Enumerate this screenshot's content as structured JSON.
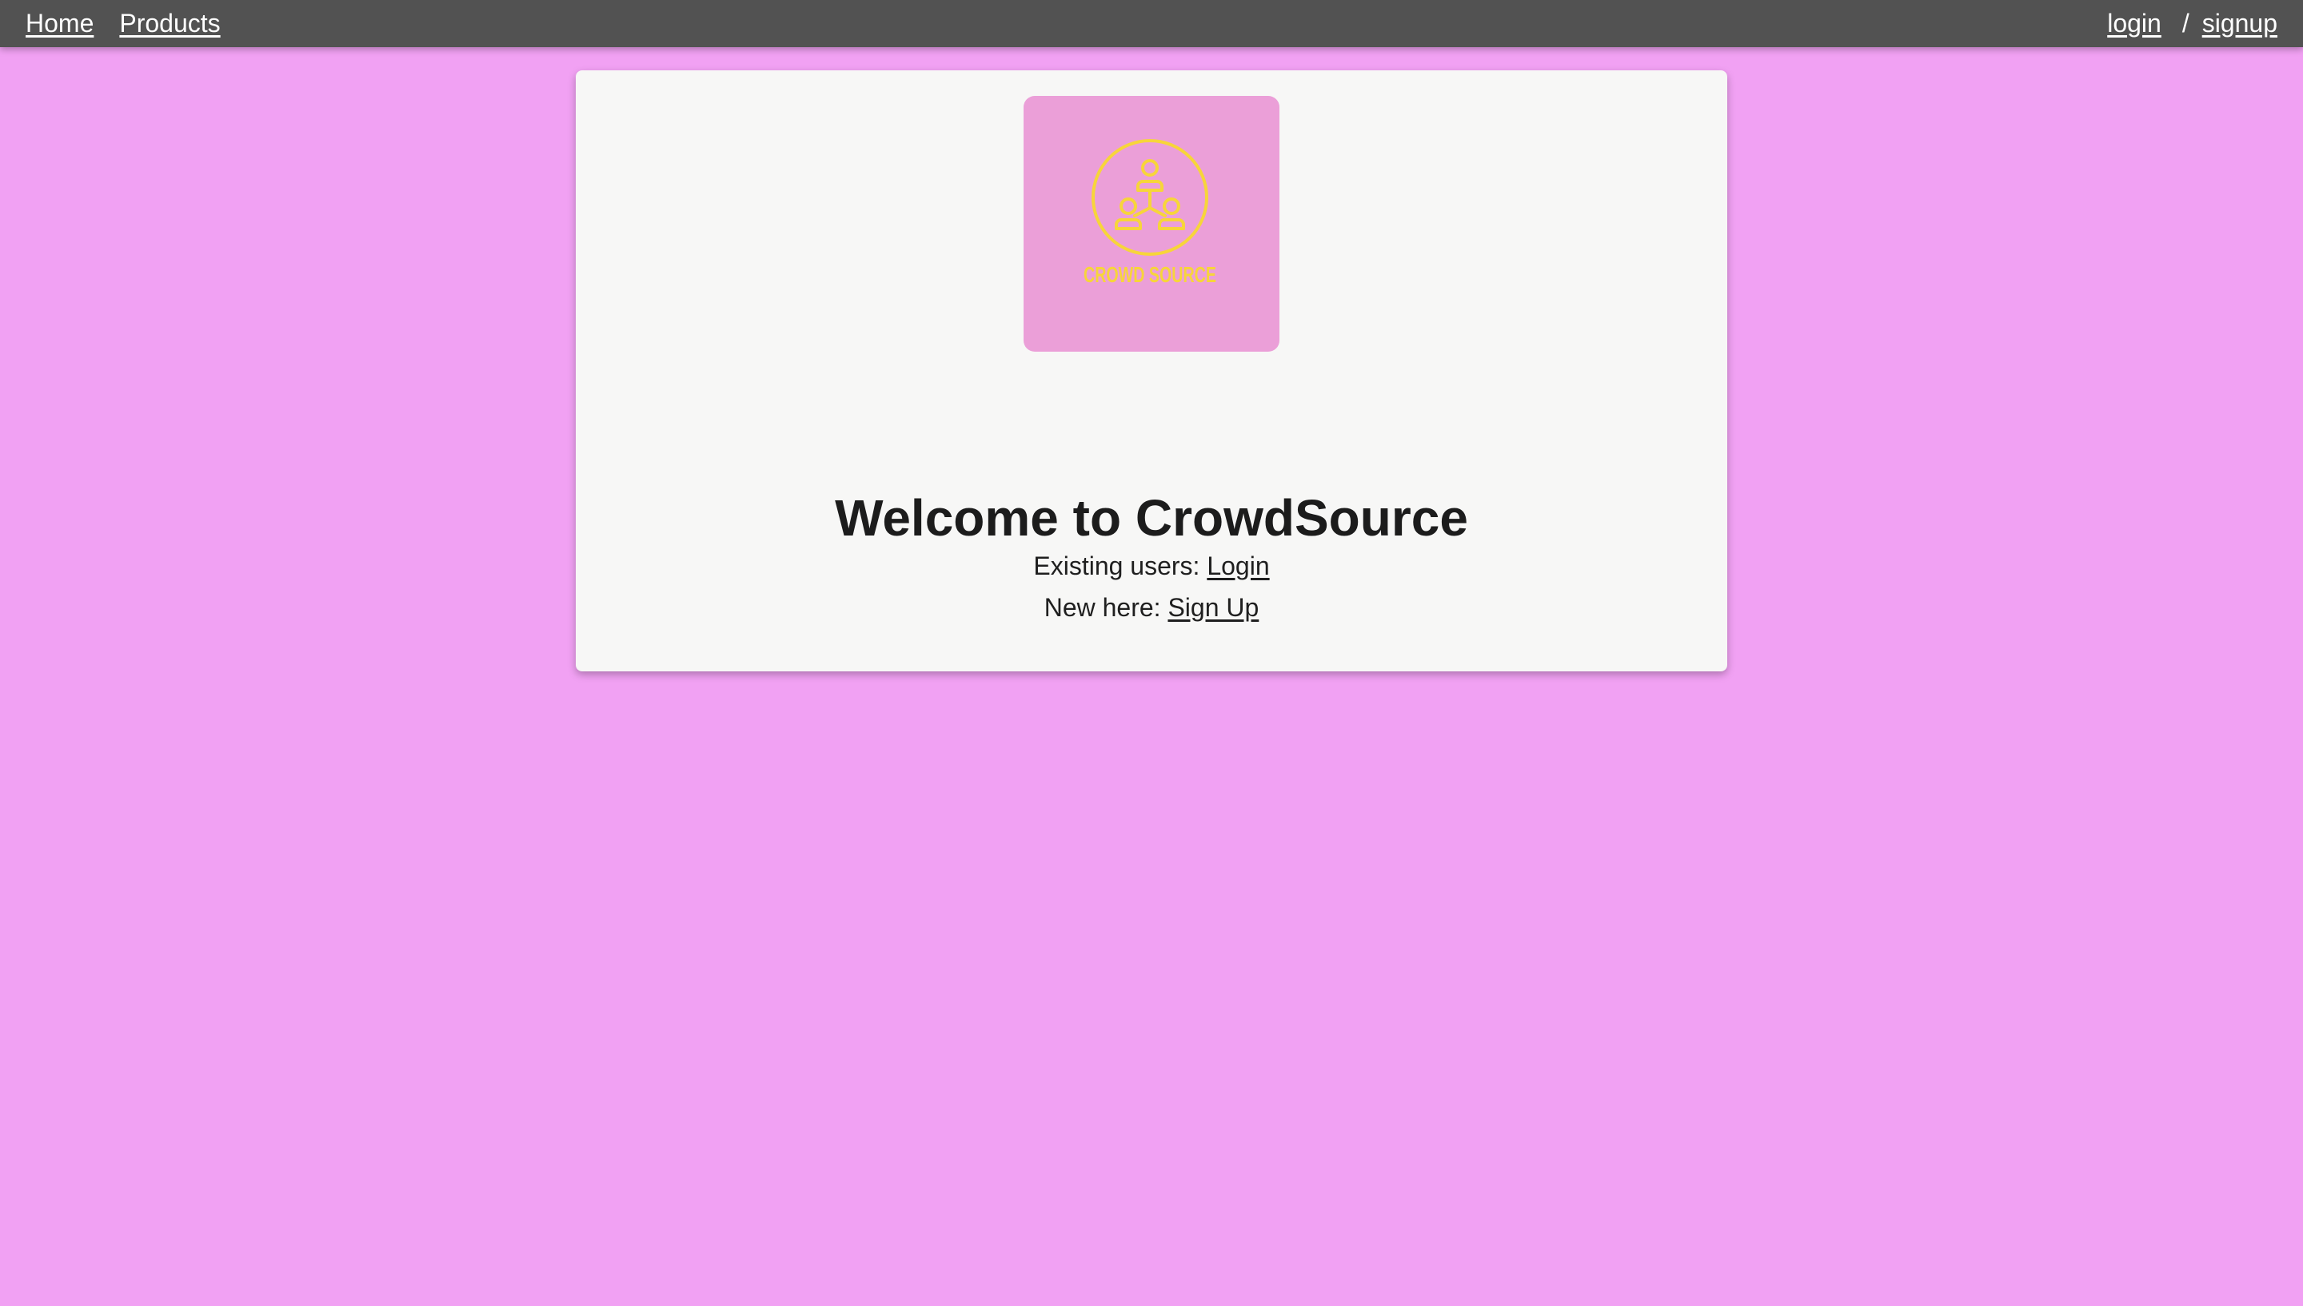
{
  "nav": {
    "home_label": "Home",
    "products_label": "Products",
    "login_label": "login",
    "separator": "/",
    "signup_label": "signup"
  },
  "logo": {
    "text": "CROWD SOURCE",
    "icon": "people-network-icon",
    "bg_color": "#eb9fd8",
    "icon_color": "#f7d53a"
  },
  "main": {
    "title": "Welcome to CrowdSource",
    "existing_prefix": "Existing users: ",
    "login_link": "Login",
    "new_prefix": "New here: ",
    "signup_link": "Sign Up"
  },
  "colors": {
    "page_bg": "#f1a1f3",
    "nav_bg": "#525252",
    "card_bg": "#f7f7f6"
  }
}
